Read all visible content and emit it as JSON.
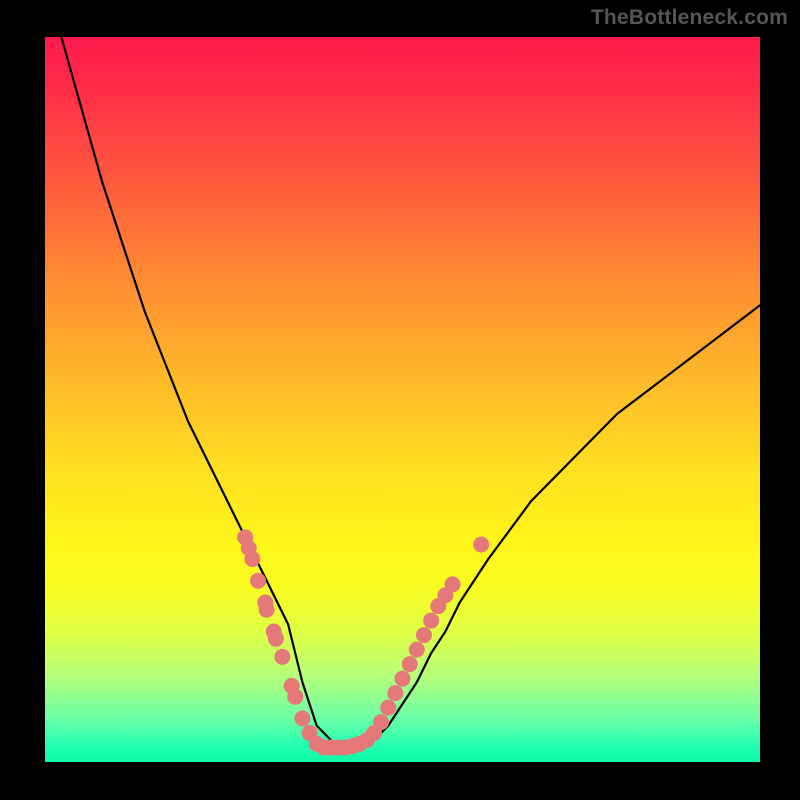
{
  "watermark": "TheBottleneck.com",
  "chart_data": {
    "type": "line",
    "title": "",
    "xlabel": "",
    "ylabel": "",
    "xlim": [
      0,
      100
    ],
    "ylim": [
      0,
      100
    ],
    "series": [
      {
        "name": "curve",
        "x": [
          2,
          4,
          6,
          8,
          10,
          12,
          14,
          16,
          18,
          20,
          22,
          24,
          26,
          28,
          30,
          32,
          34,
          35,
          36,
          37,
          38,
          40,
          42,
          44,
          46,
          48,
          50,
          52,
          54,
          56,
          58,
          60,
          62,
          65,
          68,
          72,
          76,
          80,
          84,
          88,
          92,
          96,
          100
        ],
        "y": [
          101,
          94,
          87,
          80,
          74,
          68,
          62,
          57,
          52,
          47,
          43,
          39,
          35,
          31,
          27,
          23,
          19,
          15,
          11,
          8,
          5,
          3,
          2,
          2,
          3,
          5,
          8,
          11,
          15,
          18,
          22,
          25,
          28,
          32,
          36,
          40,
          44,
          48,
          51,
          54,
          57,
          60,
          63
        ]
      }
    ],
    "markers": [
      {
        "x": 28.0,
        "y": 31.0
      },
      {
        "x": 28.5,
        "y": 29.5
      },
      {
        "x": 29.0,
        "y": 28.0
      },
      {
        "x": 29.8,
        "y": 25.0
      },
      {
        "x": 30.8,
        "y": 22.0
      },
      {
        "x": 31.0,
        "y": 21.0
      },
      {
        "x": 32.0,
        "y": 18.0
      },
      {
        "x": 32.3,
        "y": 17.0
      },
      {
        "x": 33.2,
        "y": 14.5
      },
      {
        "x": 34.5,
        "y": 10.5
      },
      {
        "x": 35.0,
        "y": 9.0
      },
      {
        "x": 36.0,
        "y": 6.0
      },
      {
        "x": 37.0,
        "y": 4.0
      },
      {
        "x": 38.0,
        "y": 2.5
      },
      {
        "x": 39.0,
        "y": 2.0
      },
      {
        "x": 40.0,
        "y": 2.0
      },
      {
        "x": 41.0,
        "y": 2.0
      },
      {
        "x": 42.0,
        "y": 2.0
      },
      {
        "x": 43.0,
        "y": 2.2
      },
      {
        "x": 44.0,
        "y": 2.5
      },
      {
        "x": 45.0,
        "y": 3.0
      },
      {
        "x": 46.0,
        "y": 4.0
      },
      {
        "x": 47.0,
        "y": 5.5
      },
      {
        "x": 48.0,
        "y": 7.5
      },
      {
        "x": 49.0,
        "y": 9.5
      },
      {
        "x": 50.0,
        "y": 11.5
      },
      {
        "x": 51.0,
        "y": 13.5
      },
      {
        "x": 52.0,
        "y": 15.5
      },
      {
        "x": 53.0,
        "y": 17.5
      },
      {
        "x": 54.0,
        "y": 19.5
      },
      {
        "x": 55.0,
        "y": 21.5
      },
      {
        "x": 56.0,
        "y": 23.0
      },
      {
        "x": 57.0,
        "y": 24.5
      },
      {
        "x": 61.0,
        "y": 30.0
      }
    ],
    "colors": {
      "curve": "#000000",
      "marker": "#e57878"
    }
  }
}
